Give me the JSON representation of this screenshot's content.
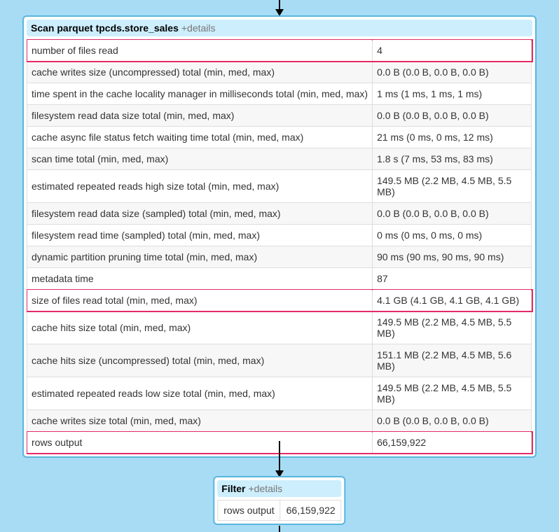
{
  "scan": {
    "title": "Scan parquet tpcds.store_sales",
    "details": "+details",
    "rows": [
      {
        "label": "number of files read",
        "value": "4",
        "highlight": true
      },
      {
        "label": "cache writes size (uncompressed) total (min, med, max)",
        "value": "0.0 B (0.0 B, 0.0 B, 0.0 B)"
      },
      {
        "label": "time spent in the cache locality manager in milliseconds total (min, med, max)",
        "value": "1 ms (1 ms, 1 ms, 1 ms)"
      },
      {
        "label": "filesystem read data size total (min, med, max)",
        "value": "0.0 B (0.0 B, 0.0 B, 0.0 B)"
      },
      {
        "label": "cache async file status fetch waiting time total (min, med, max)",
        "value": "21 ms (0 ms, 0 ms, 12 ms)"
      },
      {
        "label": "scan time total (min, med, max)",
        "value": "1.8 s (7 ms, 53 ms, 83 ms)"
      },
      {
        "label": "estimated repeated reads high size total (min, med, max)",
        "value": "149.5 MB (2.2 MB, 4.5 MB, 5.5 MB)"
      },
      {
        "label": "filesystem read data size (sampled) total (min, med, max)",
        "value": "0.0 B (0.0 B, 0.0 B, 0.0 B)"
      },
      {
        "label": "filesystem read time (sampled) total (min, med, max)",
        "value": "0 ms (0 ms, 0 ms, 0 ms)"
      },
      {
        "label": "dynamic partition pruning time total (min, med, max)",
        "value": "90 ms (90 ms, 90 ms, 90 ms)"
      },
      {
        "label": "metadata time",
        "value": "87"
      },
      {
        "label": "size of files read total (min, med, max)",
        "value": "4.1 GB (4.1 GB, 4.1 GB, 4.1 GB)",
        "highlight": true
      },
      {
        "label": "cache hits size total (min, med, max)",
        "value": "149.5 MB (2.2 MB, 4.5 MB, 5.5 MB)"
      },
      {
        "label": "cache hits size (uncompressed) total (min, med, max)",
        "value": "151.1 MB (2.2 MB, 4.5 MB, 5.6 MB)"
      },
      {
        "label": "estimated repeated reads low size total (min, med, max)",
        "value": "149.5 MB (2.2 MB, 4.5 MB, 5.5 MB)"
      },
      {
        "label": "cache writes size total (min, med, max)",
        "value": "0.0 B (0.0 B, 0.0 B, 0.0 B)"
      },
      {
        "label": "rows output",
        "value": "66,159,922",
        "highlight": true
      }
    ]
  },
  "filter": {
    "title": "Filter",
    "details": "+details",
    "rows": [
      {
        "label": "rows output",
        "value": "66,159,922"
      }
    ]
  }
}
